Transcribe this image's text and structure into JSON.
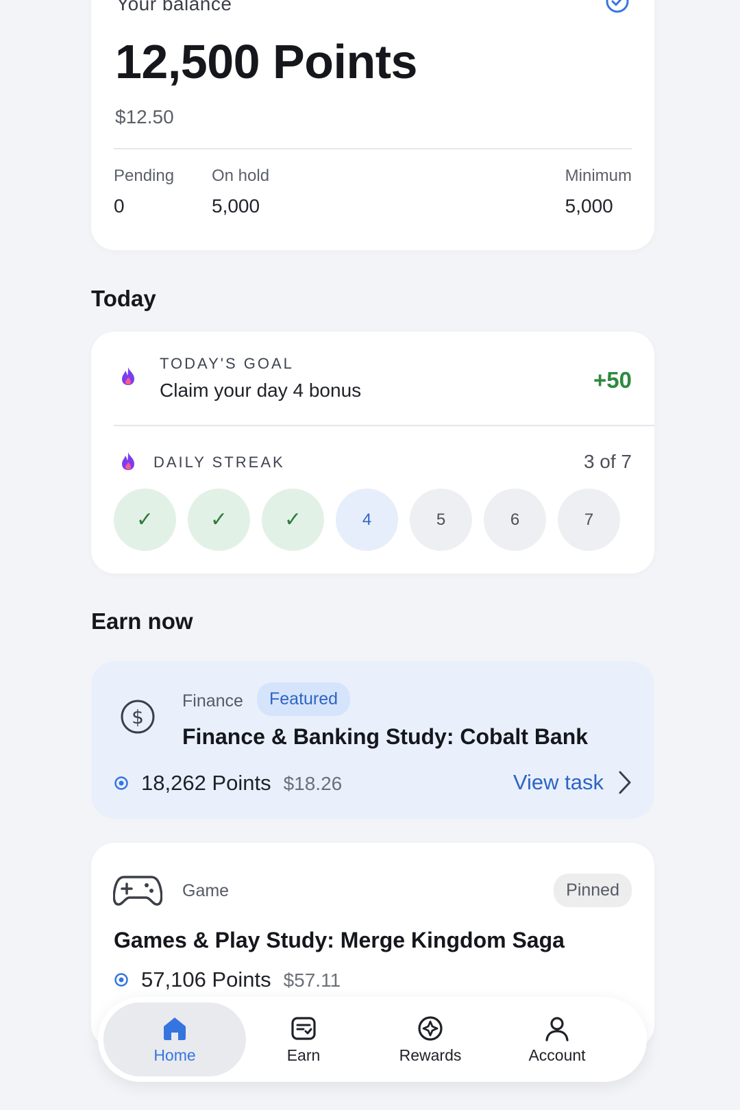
{
  "balance": {
    "title": "Your balance",
    "points": "12,500 Points",
    "usd": "$12.50",
    "stats": [
      {
        "label": "Pending",
        "value": "0"
      },
      {
        "label": "On hold",
        "value": "5,000"
      },
      {
        "label": "Minimum",
        "value": "5,000"
      }
    ]
  },
  "today": {
    "section_title": "Today",
    "goal_kicker": "TODAY'S GOAL",
    "goal_text": "Claim your day 4 bonus",
    "goal_reward": "+50",
    "streak_kicker": "DAILY STREAK",
    "streak_count": "3 of 7",
    "days": [
      {
        "label": "✓",
        "state": "done"
      },
      {
        "label": "✓",
        "state": "done"
      },
      {
        "label": "✓",
        "state": "done"
      },
      {
        "label": "4",
        "state": "current"
      },
      {
        "label": "5",
        "state": "upcoming"
      },
      {
        "label": "6",
        "state": "upcoming"
      },
      {
        "label": "7",
        "state": "upcoming"
      }
    ]
  },
  "earn": {
    "section_title": "Earn now",
    "tasks": [
      {
        "category": "Finance",
        "badge": "Featured",
        "title": "Finance & Banking Study: Cobalt Bank",
        "points": "18,262 Points",
        "usd": "$18.26",
        "action": "View task",
        "icon": "dollar-circle-icon"
      },
      {
        "category": "Game",
        "badge": "Pinned",
        "title": "Games & Play Study: Merge Kingdom Saga",
        "points": "57,106 Points",
        "usd": "$57.11",
        "icon": "gamepad-icon"
      }
    ]
  },
  "nav": {
    "items": [
      {
        "label": "Home",
        "icon": "home-icon",
        "active": true
      },
      {
        "label": "Earn",
        "icon": "earn-icon",
        "active": false
      },
      {
        "label": "Rewards",
        "icon": "rewards-icon",
        "active": false
      },
      {
        "label": "Account",
        "icon": "account-icon",
        "active": false
      }
    ]
  },
  "colors": {
    "accent": "#3575e0",
    "success": "#2f8a3f",
    "streak_flame": "#7a3df0",
    "featured_bg": "#e9f0fc",
    "page_bg": "#f3f4f7"
  }
}
